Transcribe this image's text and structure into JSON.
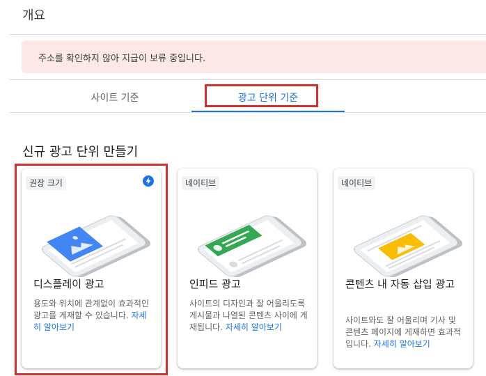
{
  "header": {
    "title": "개요"
  },
  "alert": {
    "message": "주소를 확인하지 않아 지급이 보류 중입니다."
  },
  "tabs": [
    {
      "label": "사이트 기준",
      "selected": false
    },
    {
      "label": "광고 단위 기준",
      "selected": true
    }
  ],
  "section": {
    "title": "신규 광고 단위 만들기"
  },
  "cards": [
    {
      "chip": "권장 크기",
      "badge_icon": "bolt-icon",
      "title": "디스플레이 광고",
      "description": "용도와 위치에 관계없이 효과적인 광고를 게재할 수 있습니다. ",
      "link": "자세히 알아보기",
      "accent_color": "#4285f4"
    },
    {
      "chip": "네이티브",
      "title": "인피드 광고",
      "description": "사이트의 디자인과 잘 어울리도록 게시물과 나열된 콘텐츠 사이에 게재됩니다. ",
      "link": "자세히 알아보기",
      "accent_color": "#34a853"
    },
    {
      "chip": "네이티브",
      "title": "콘텐츠 내 자동 삽입 광고",
      "description": "사이트와도 잘 어울리며 기사 및 콘텐츠 페이지에 게재하면 효과적입니다. ",
      "link": "자세히 알아보기",
      "accent_color": "#fbbc04"
    }
  ],
  "colors": {
    "primary": "#1a73e8",
    "alert_background": "#fce8e6",
    "highlight_border": "#d32f2f"
  }
}
